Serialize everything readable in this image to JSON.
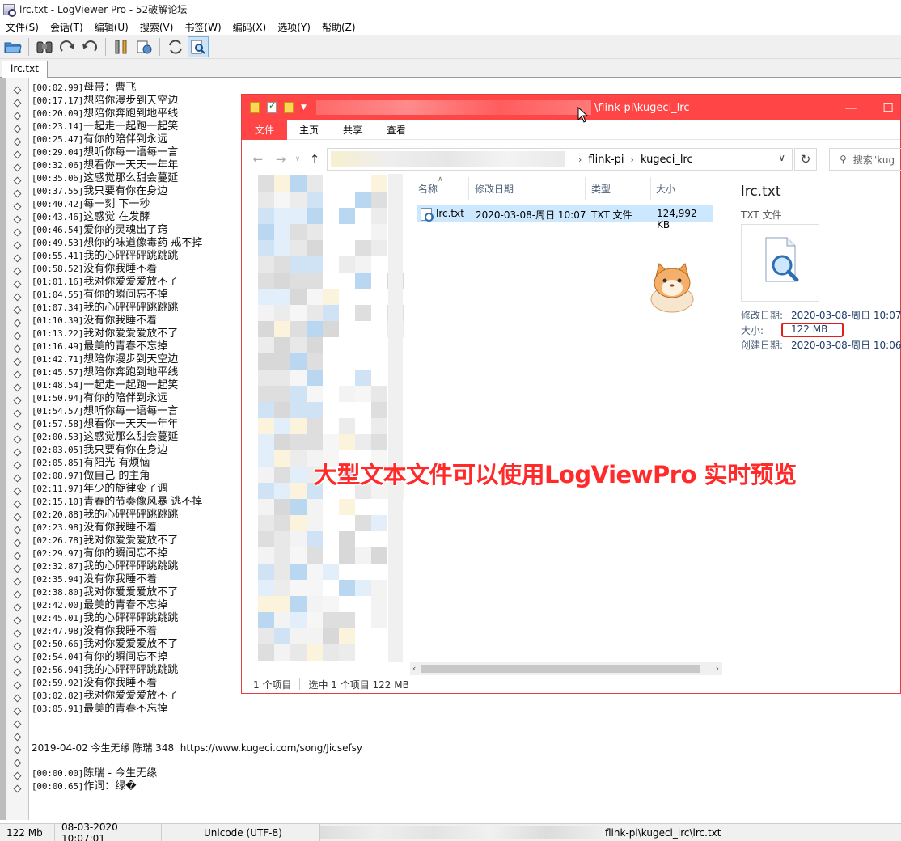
{
  "window": {
    "title": "lrc.txt - LogViewer Pro - 52破解论坛"
  },
  "menu": [
    "文件(S)",
    "会话(T)",
    "编辑(U)",
    "搜索(V)",
    "书签(W)",
    "编码(X)",
    "选项(Y)",
    "帮助(Z)"
  ],
  "tab": {
    "label": "lrc.txt"
  },
  "log_lines": [
    {
      "ts": "[00:02.99]",
      "text": "母带：曹飞"
    },
    {
      "ts": "[00:17.17]",
      "text": "想陪你漫步到天空边"
    },
    {
      "ts": "[00:20.09]",
      "text": "想陪你奔跑到地平线"
    },
    {
      "ts": "[00:23.14]",
      "text": "一起走一起跑一起笑"
    },
    {
      "ts": "[00:25.47]",
      "text": "有你的陪伴到永远"
    },
    {
      "ts": "[00:29.04]",
      "text": "想听你每一语每一言"
    },
    {
      "ts": "[00:32.06]",
      "text": "想看你一天天一年年"
    },
    {
      "ts": "[00:35.06]",
      "text": "这感觉那么甜会蔓延"
    },
    {
      "ts": "[00:37.55]",
      "text": "我只要有你在身边"
    },
    {
      "ts": "[00:40.42]",
      "text": "每一刻 下一秒"
    },
    {
      "ts": "[00:43.46]",
      "text": "这感觉 在发酵"
    },
    {
      "ts": "[00:46.54]",
      "text": "爱你的灵魂出了窍"
    },
    {
      "ts": "[00:49.53]",
      "text": "想你的味道像毒药 戒不掉"
    },
    {
      "ts": "[00:55.41]",
      "text": "我的心砰砰砰跳跳跳"
    },
    {
      "ts": "[00:58.52]",
      "text": "没有你我睡不着"
    },
    {
      "ts": "[01:01.16]",
      "text": "我对你爱爱爱放不了"
    },
    {
      "ts": "[01:04.55]",
      "text": "有你的瞬间忘不掉"
    },
    {
      "ts": "[01:07.34]",
      "text": "我的心砰砰砰跳跳跳"
    },
    {
      "ts": "[01:10.39]",
      "text": "没有你我睡不着"
    },
    {
      "ts": "[01:13.22]",
      "text": "我对你爱爱爱放不了"
    },
    {
      "ts": "[01:16.49]",
      "text": "最美的青春不忘掉"
    },
    {
      "ts": "[01:42.71]",
      "text": "想陪你漫步到天空边"
    },
    {
      "ts": "[01:45.57]",
      "text": "想陪你奔跑到地平线"
    },
    {
      "ts": "[01:48.54]",
      "text": "一起走一起跑一起笑"
    },
    {
      "ts": "[01:50.94]",
      "text": "有你的陪伴到永远"
    },
    {
      "ts": "[01:54.57]",
      "text": "想听你每一语每一言"
    },
    {
      "ts": "[01:57.58]",
      "text": "想看你一天天一年年"
    },
    {
      "ts": "[02:00.53]",
      "text": "这感觉那么甜会蔓延"
    },
    {
      "ts": "[02:03.05]",
      "text": "我只要有你在身边"
    },
    {
      "ts": "[02:05.85]",
      "text": "有阳光 有烦恼"
    },
    {
      "ts": "[02:08.97]",
      "text": "做自己 的主角"
    },
    {
      "ts": "[02:11.97]",
      "text": "年少的旋律变了调"
    },
    {
      "ts": "[02:15.10]",
      "text": "青春的节奏像风暴 逃不掉"
    },
    {
      "ts": "[02:20.88]",
      "text": "我的心砰砰砰跳跳跳"
    },
    {
      "ts": "[02:23.98]",
      "text": "没有你我睡不着"
    },
    {
      "ts": "[02:26.78]",
      "text": "我对你爱爱爱放不了"
    },
    {
      "ts": "[02:29.97]",
      "text": "有你的瞬间忘不掉"
    },
    {
      "ts": "[02:32.87]",
      "text": "我的心砰砰砰跳跳跳"
    },
    {
      "ts": "[02:35.94]",
      "text": "没有你我睡不着"
    },
    {
      "ts": "[02:38.80]",
      "text": "我对你爱爱爱放不了"
    },
    {
      "ts": "[02:42.00]",
      "text": "最美的青春不忘掉"
    },
    {
      "ts": "[02:45.01]",
      "text": "我的心砰砰砰跳跳跳"
    },
    {
      "ts": "[02:47.98]",
      "text": "没有你我睡不着"
    },
    {
      "ts": "[02:50.66]",
      "text": "我对你爱爱爱放不了"
    },
    {
      "ts": "[02:54.04]",
      "text": "有你的瞬间忘不掉"
    },
    {
      "ts": "[02:56.94]",
      "text": "我的心砰砰砰跳跳跳"
    },
    {
      "ts": "[02:59.92]",
      "text": "没有你我睡不着"
    },
    {
      "ts": "[03:02.82]",
      "text": "我对你爱爱爱放不了"
    },
    {
      "ts": "[03:05.91]",
      "text": "最美的青春不忘掉"
    },
    {
      "ts": "",
      "text": ""
    },
    {
      "ts": "",
      "text": ""
    },
    {
      "ts": "",
      "text": "2019-04-02 今生无缘 陈瑞 348  https://www.kugeci.com/song/Jicsefsy"
    },
    {
      "ts": "",
      "text": ""
    },
    {
      "ts": "[00:00.00]",
      "text": "陈瑞 - 今生无缘"
    },
    {
      "ts": "[00:00.65]",
      "text": "作词：绿�"
    }
  ],
  "status": {
    "size": "122 Mb",
    "datetime": "08-03-2020 10:07:01",
    "encoding": "Unicode (UTF-8)",
    "path_suffix": "flink-pi\\kugeci_lrc\\lrc.txt"
  },
  "explorer": {
    "title_path": "\\flink-pi\\kugeci_lrc",
    "ribbon_tabs": [
      "文件",
      "主页",
      "共享",
      "查看"
    ],
    "breadcrumb": [
      "flink-pi",
      "kugeci_lrc"
    ],
    "search_placeholder": "搜索\"kug",
    "columns": {
      "name": "名称",
      "date": "修改日期",
      "type": "类型",
      "size": "大小"
    },
    "file": {
      "name": "lrc.txt",
      "date": "2020-03-08-周日 10:07",
      "type": "TXT 文件",
      "size": "124,992 KB"
    },
    "preview": {
      "name": "lrc.txt",
      "type": "TXT 文件",
      "modified_label": "修改日期:",
      "modified_value": "2020-03-08-周日 10:07",
      "size_label": "大小:",
      "size_value": "122 MB",
      "created_label": "创建日期:",
      "created_value": "2020-03-08-周日 10:06"
    },
    "status": {
      "items": "1 个项目",
      "selected": "选中 1 个项目  122 MB"
    }
  },
  "overlay": {
    "caption": "大型文本文件可以使用LogViewPro 实时预览"
  },
  "colors": {
    "explorer_accent": "#ff4545",
    "highlight_box": "#e0201c",
    "caption": "#ff2a2a",
    "selection": "#cce8ff"
  }
}
